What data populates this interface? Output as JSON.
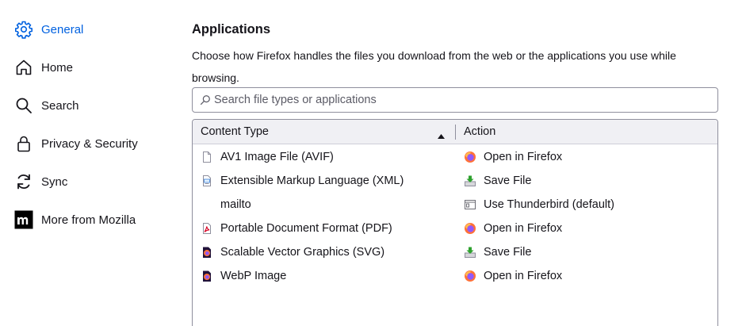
{
  "sidebar": {
    "items": [
      {
        "label": "General",
        "icon": "gear-icon",
        "active": true
      },
      {
        "label": "Home",
        "icon": "home-icon"
      },
      {
        "label": "Search",
        "icon": "search-icon"
      },
      {
        "label": "Privacy & Security",
        "icon": "lock-icon"
      },
      {
        "label": "Sync",
        "icon": "sync-icon"
      },
      {
        "label": "More from Mozilla",
        "icon": "mozilla-logo-icon"
      }
    ]
  },
  "applications": {
    "heading": "Applications",
    "description": "Choose how Firefox handles the files you download from the web or the applications you use while browsing.",
    "search_placeholder": "Search file types or applications",
    "search_value": "",
    "columns": {
      "content_type": "Content Type",
      "action": "Action"
    },
    "rows": [
      {
        "type": "AV1 Image File (AVIF)",
        "type_icon": "blank-file-icon",
        "action": "Open in Firefox",
        "action_icon": "firefox-icon"
      },
      {
        "type": "Extensible Markup Language (XML)",
        "type_icon": "xml-file-icon",
        "action": "Save File",
        "action_icon": "save-file-icon"
      },
      {
        "type": "mailto",
        "type_icon": "",
        "action": "Use Thunderbird (default)",
        "action_icon": "app-window-icon"
      },
      {
        "type": "Portable Document Format (PDF)",
        "type_icon": "pdf-file-icon",
        "action": "Open in Firefox",
        "action_icon": "firefox-icon"
      },
      {
        "type": "Scalable Vector Graphics (SVG)",
        "type_icon": "firefox-doc-icon",
        "action": "Save File",
        "action_icon": "save-file-icon"
      },
      {
        "type": "WebP Image",
        "type_icon": "firefox-doc-icon",
        "action": "Open in Firefox",
        "action_icon": "firefox-icon"
      }
    ]
  },
  "colors": {
    "accent": "#0061e0",
    "text": "#15141a"
  }
}
